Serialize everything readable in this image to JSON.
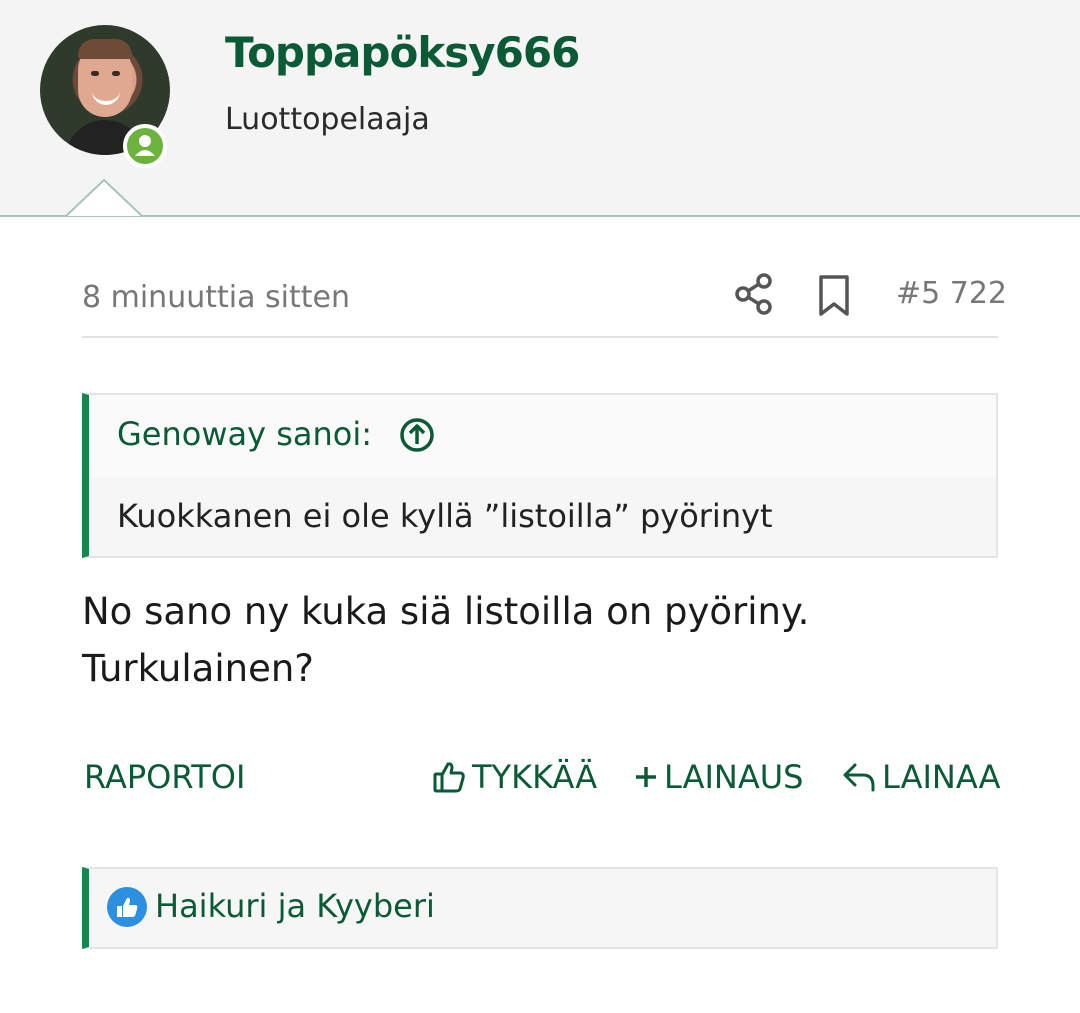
{
  "user": {
    "name": "Toppapöksy666",
    "title": "Luottopelaaja",
    "status_color": "#6cb33e",
    "accent_color": "#0a5a36"
  },
  "post": {
    "timestamp": "8 minuuttia sitten",
    "number": "#5 722",
    "share_icon": "share-icon",
    "bookmark_icon": "bookmark-icon",
    "quote": {
      "author": "Genoway sanoi:",
      "text": "Kuokkanen ei ole kyllä ”listoilla” pyörinyt"
    },
    "body_line1": "No sano ny kuka siä listoilla on pyöriny.",
    "body_line2": "Turkulainen?"
  },
  "actions": {
    "report": "RAPORTOI",
    "like": "TYKKÄÄ",
    "quote_add": "LAINAUS",
    "reply": "LAINAA"
  },
  "reactions": {
    "text": "Haikuri ja Kyyberi",
    "icon_color": "#2d8fe0"
  }
}
